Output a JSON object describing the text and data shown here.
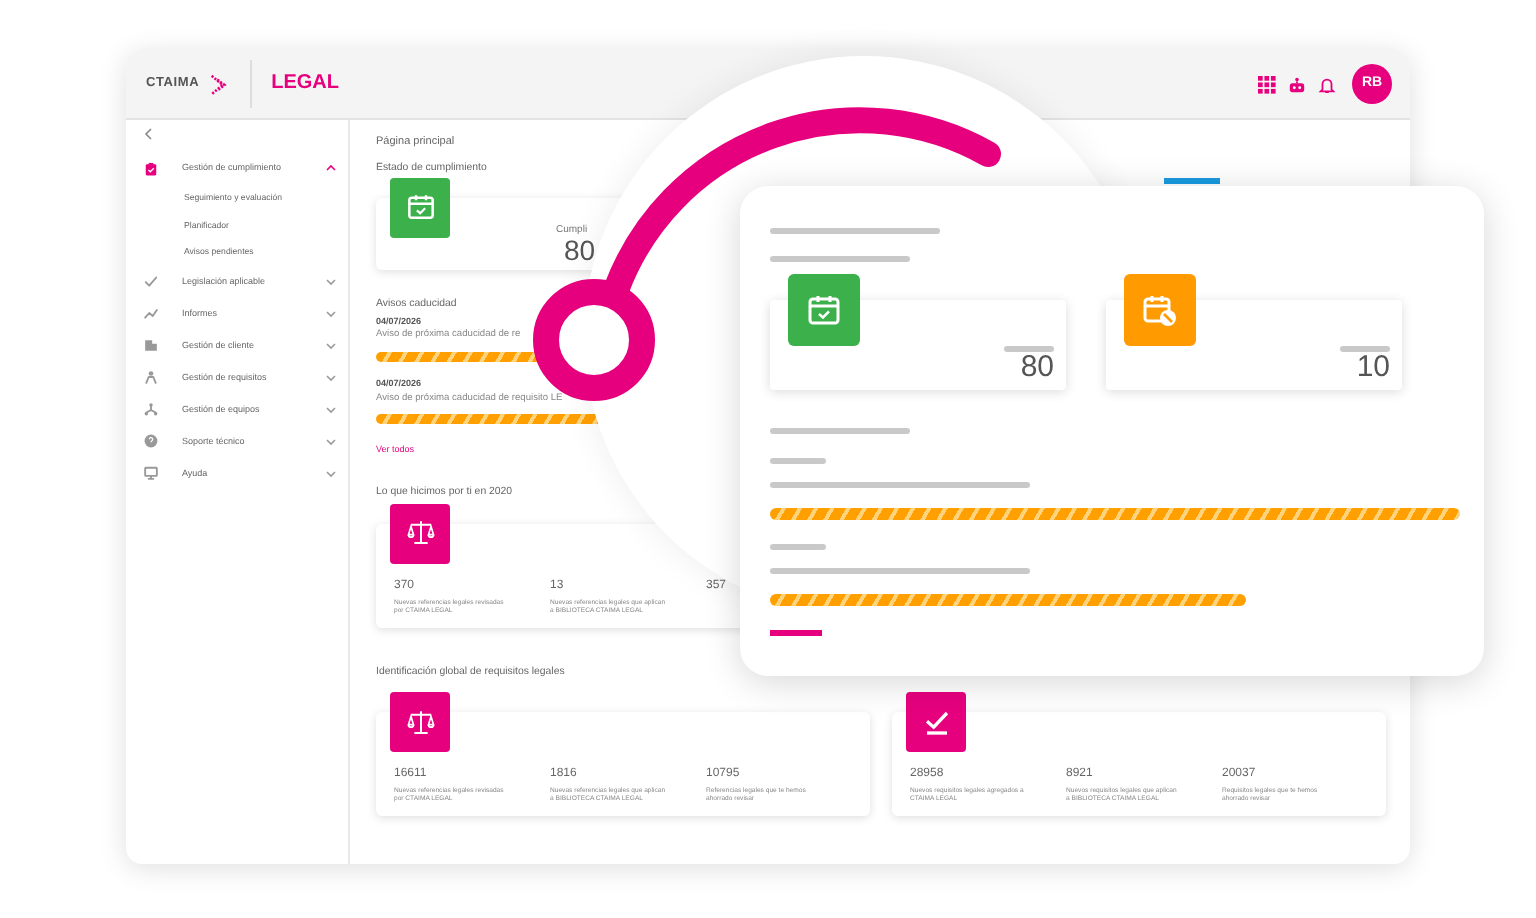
{
  "header": {
    "logo_text": "CTAIMA",
    "product": "LEGAL",
    "avatar": "RB"
  },
  "sidebar": {
    "items": [
      {
        "label": "Gestión de cumplimiento",
        "selected": true,
        "expanded": true,
        "children": [
          {
            "label": "Seguimiento y evaluación"
          },
          {
            "label": "Planificador"
          },
          {
            "label": "Avisos pendientes"
          }
        ]
      },
      {
        "label": "Legislación aplicable",
        "selected": false,
        "expanded": false
      },
      {
        "label": "Informes",
        "selected": false,
        "expanded": false
      },
      {
        "label": "Gestión de cliente",
        "selected": false,
        "expanded": false
      },
      {
        "label": "Gestión de requisitos",
        "selected": false,
        "expanded": false
      },
      {
        "label": "Gestión de equipos",
        "selected": false,
        "expanded": false
      },
      {
        "label": "Soporte técnico",
        "selected": false,
        "expanded": false
      },
      {
        "label": "Ayuda",
        "selected": false,
        "expanded": false
      }
    ]
  },
  "main": {
    "title": "Página principal",
    "status": {
      "heading": "Estado de cumplimiento",
      "label": "Cumpli",
      "value": "80"
    },
    "expiry": {
      "heading": "Avisos caducidad",
      "notices": [
        {
          "date": "04/07/2026",
          "text": "Aviso de próxima caducidad de re"
        },
        {
          "date": "04/07/2026",
          "text": "Aviso de próxima caducidad de requisito LE"
        }
      ],
      "link": "Ver todos"
    },
    "year_summary": {
      "heading": "Lo que hicimos por ti en 2020",
      "stats": [
        {
          "value": "370",
          "label": "Nuevas referencias legales revisadas por CTAIMA LEGAL"
        },
        {
          "value": "13",
          "label": "Nuevas referencias legales que aplican a BIBLIOTECA CTAIMA LEGAL"
        },
        {
          "value": "357"
        }
      ]
    },
    "global": {
      "heading": "Identificación global de requisitos legales",
      "cards": [
        {
          "stats": [
            {
              "value": "16611",
              "label": "Nuevas referencias legales revisadas por CTAIMA LEGAL"
            },
            {
              "value": "1816",
              "label": "Nuevas referencias legales que aplican a BIBLIOTECA CTAIMA LEGAL"
            },
            {
              "value": "10795",
              "label": "Referencias legales que te hemos ahorrado revisar"
            }
          ]
        },
        {
          "stats": [
            {
              "value": "28958",
              "label": "Nuevos requisitos legales agregados a CTAIMA LEGAL"
            },
            {
              "value": "8921",
              "label": "Nuevos requisitos legales que aplican a BIBLIOTECA CTAIMA LEGAL"
            },
            {
              "value": "20037",
              "label": "Requisitos legales que te hemos ahorrado revisar"
            }
          ]
        }
      ]
    }
  },
  "zoom_card": {
    "stats": [
      {
        "value": "80",
        "color": "#3cb04b"
      },
      {
        "value": "10",
        "color": "#ff9a00"
      }
    ]
  }
}
